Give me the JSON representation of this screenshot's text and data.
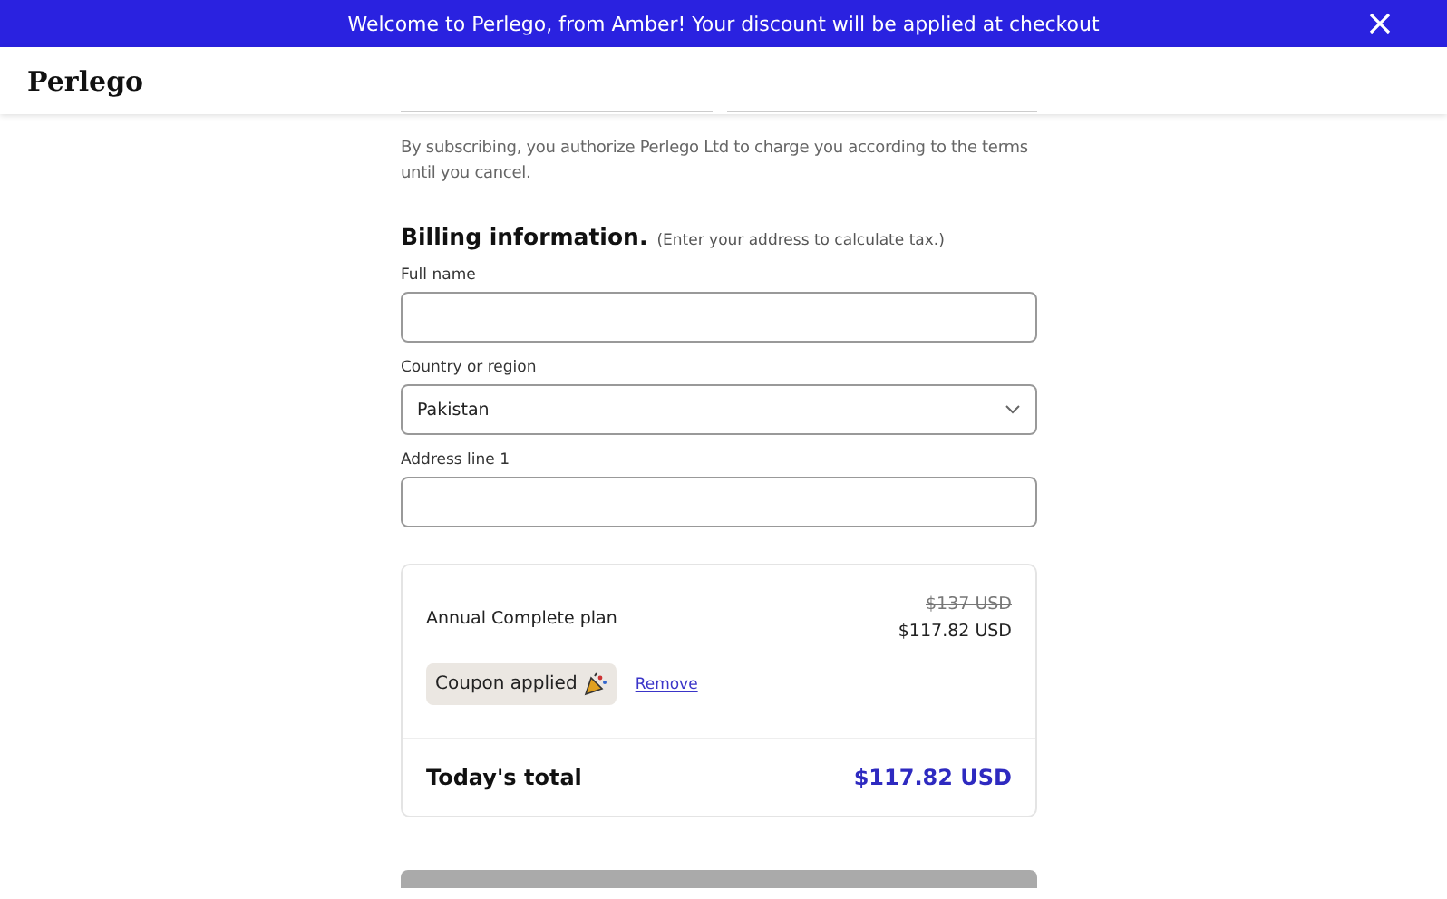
{
  "banner": {
    "text": "Welcome to Perlego, from Amber! Your discount will be applied at checkout"
  },
  "header": {
    "logo": "Perlego"
  },
  "consent_text": "By subscribing, you authorize Perlego Ltd to charge you according to the terms until you cancel.",
  "billing": {
    "title": "Billing information.",
    "hint": "(Enter your address to calculate tax.)",
    "fields": [
      {
        "kind": "input",
        "label": "Full name"
      },
      {
        "kind": "select",
        "label": "Country or region",
        "value": "Pakistan"
      },
      {
        "kind": "input",
        "label": "Address line 1"
      }
    ]
  },
  "summary": {
    "plan": "Annual Complete plan",
    "old_price": "$137 USD",
    "price": "$117.82 USD",
    "coupon": "Coupon applied",
    "remove_link": "Remove",
    "total_label": "Today's total",
    "total": "$117.82 USD"
  }
}
